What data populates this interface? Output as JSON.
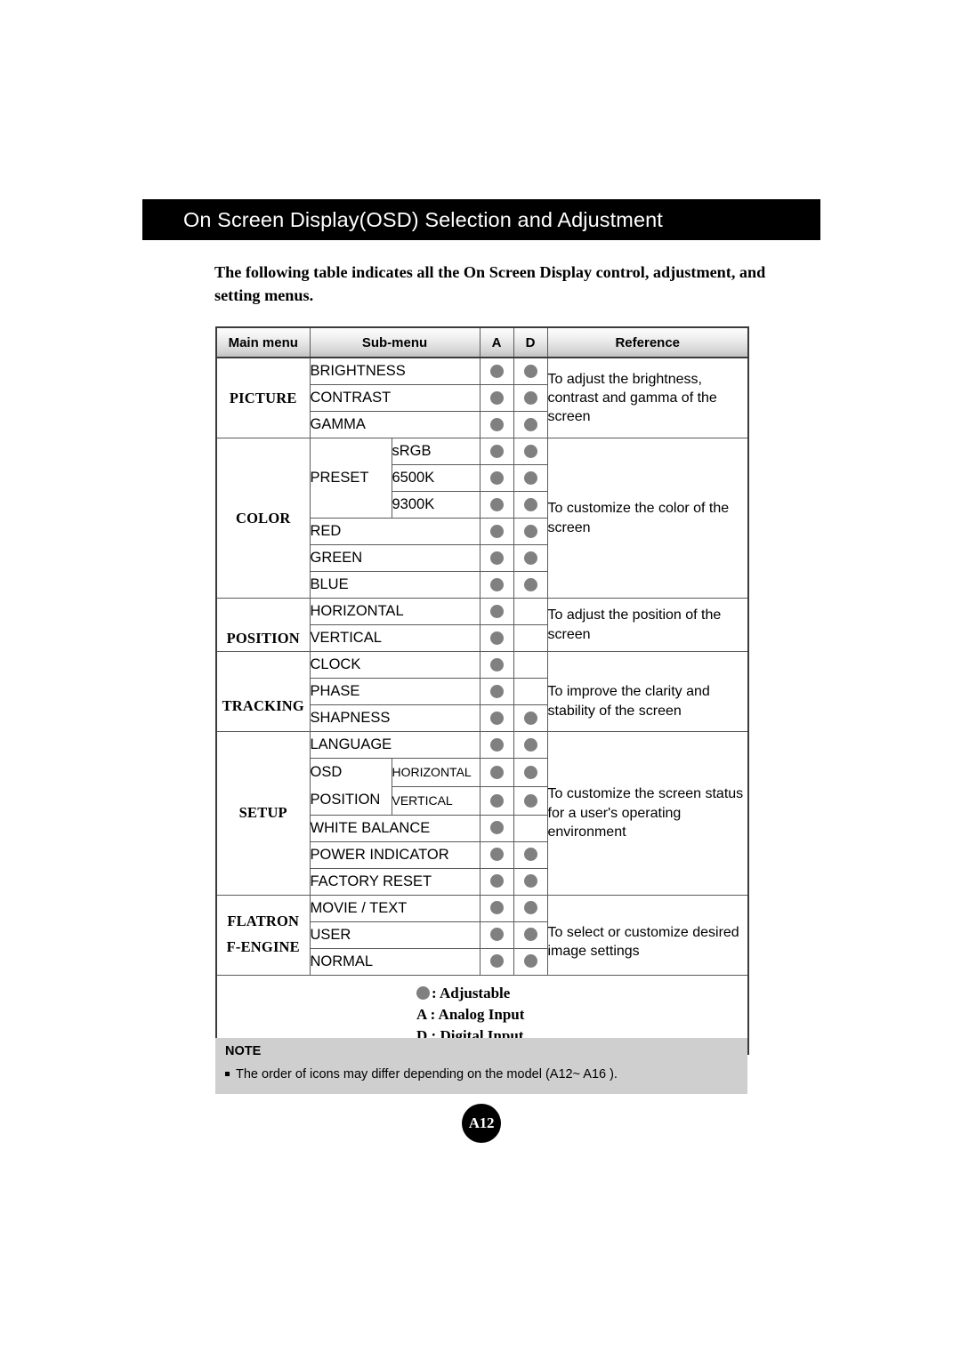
{
  "page": {
    "title": "On Screen Display(OSD) Selection and Adjustment",
    "intro": "The following table indicates all the On Screen Display control, adjustment, and setting menus.",
    "page_number": "A12"
  },
  "table": {
    "headers": {
      "main_menu": "Main menu",
      "sub_menu": "Sub-menu",
      "a": "A",
      "d": "D",
      "reference": "Reference"
    },
    "sections": [
      {
        "main_menu": "PICTURE",
        "reference": "To adjust the brightness, contrast and gamma of the screen",
        "rows": [
          {
            "sub": "BRIGHTNESS",
            "a": true,
            "d": true
          },
          {
            "sub": "CONTRAST",
            "a": true,
            "d": true
          },
          {
            "sub": "GAMMA",
            "a": true,
            "d": true
          }
        ]
      },
      {
        "main_menu": "COLOR",
        "reference": "To customize the color of the screen",
        "group_label": "PRESET",
        "rows": [
          {
            "sub": "sRGB",
            "a": true,
            "d": true
          },
          {
            "sub": "6500K",
            "a": true,
            "d": true
          },
          {
            "sub": "9300K",
            "a": true,
            "d": true
          },
          {
            "sub": "RED",
            "a": true,
            "d": true
          },
          {
            "sub": "GREEN",
            "a": true,
            "d": true
          },
          {
            "sub": "BLUE",
            "a": true,
            "d": true
          }
        ]
      },
      {
        "main_menu": "POSITION",
        "reference": "To adjust the position of the screen",
        "rows": [
          {
            "sub": "HORIZONTAL",
            "a": true,
            "d": false
          },
          {
            "sub": "VERTICAL",
            "a": true,
            "d": false
          }
        ]
      },
      {
        "main_menu": "TRACKING",
        "reference": "To improve the clarity and stability of the screen",
        "rows": [
          {
            "sub": "CLOCK",
            "a": true,
            "d": false
          },
          {
            "sub": "PHASE",
            "a": true,
            "d": false
          },
          {
            "sub": "SHAPNESS",
            "a": true,
            "d": true
          }
        ]
      },
      {
        "main_menu": "SETUP",
        "reference": "To customize the screen status for a user's operating environment",
        "group_label": "OSD POSITION",
        "rows": [
          {
            "sub": "LANGUAGE",
            "a": true,
            "d": true
          },
          {
            "sub": "HORIZONTAL",
            "a": true,
            "d": true
          },
          {
            "sub": "VERTICAL",
            "a": true,
            "d": true
          },
          {
            "sub": "WHITE BALANCE",
            "a": true,
            "d": false
          },
          {
            "sub": "POWER INDICATOR",
            "a": true,
            "d": true
          },
          {
            "sub": "FACTORY RESET",
            "a": true,
            "d": true
          }
        ]
      },
      {
        "main_menu": "FLATRON F-ENGINE",
        "main_menu_line1": "FLATRON",
        "main_menu_line2": "F-ENGINE",
        "reference": "To select or customize desired image settings",
        "rows": [
          {
            "sub": "MOVIE / TEXT",
            "a": true,
            "d": true
          },
          {
            "sub": "USER",
            "a": true,
            "d": true
          },
          {
            "sub": "NORMAL",
            "a": true,
            "d": true
          }
        ]
      }
    ],
    "legend": {
      "adjustable": ": Adjustable",
      "analog": "A : Analog Input",
      "digital": "D : Digital Input"
    }
  },
  "note": {
    "title": "NOTE",
    "text": "The order of icons may differ depending on the model (A12~ A16 )."
  },
  "colors": {
    "dot": "#808080",
    "title_bar": "#000000",
    "note_bg": "#cfcfcf",
    "table_border": "#5a5a5a"
  }
}
